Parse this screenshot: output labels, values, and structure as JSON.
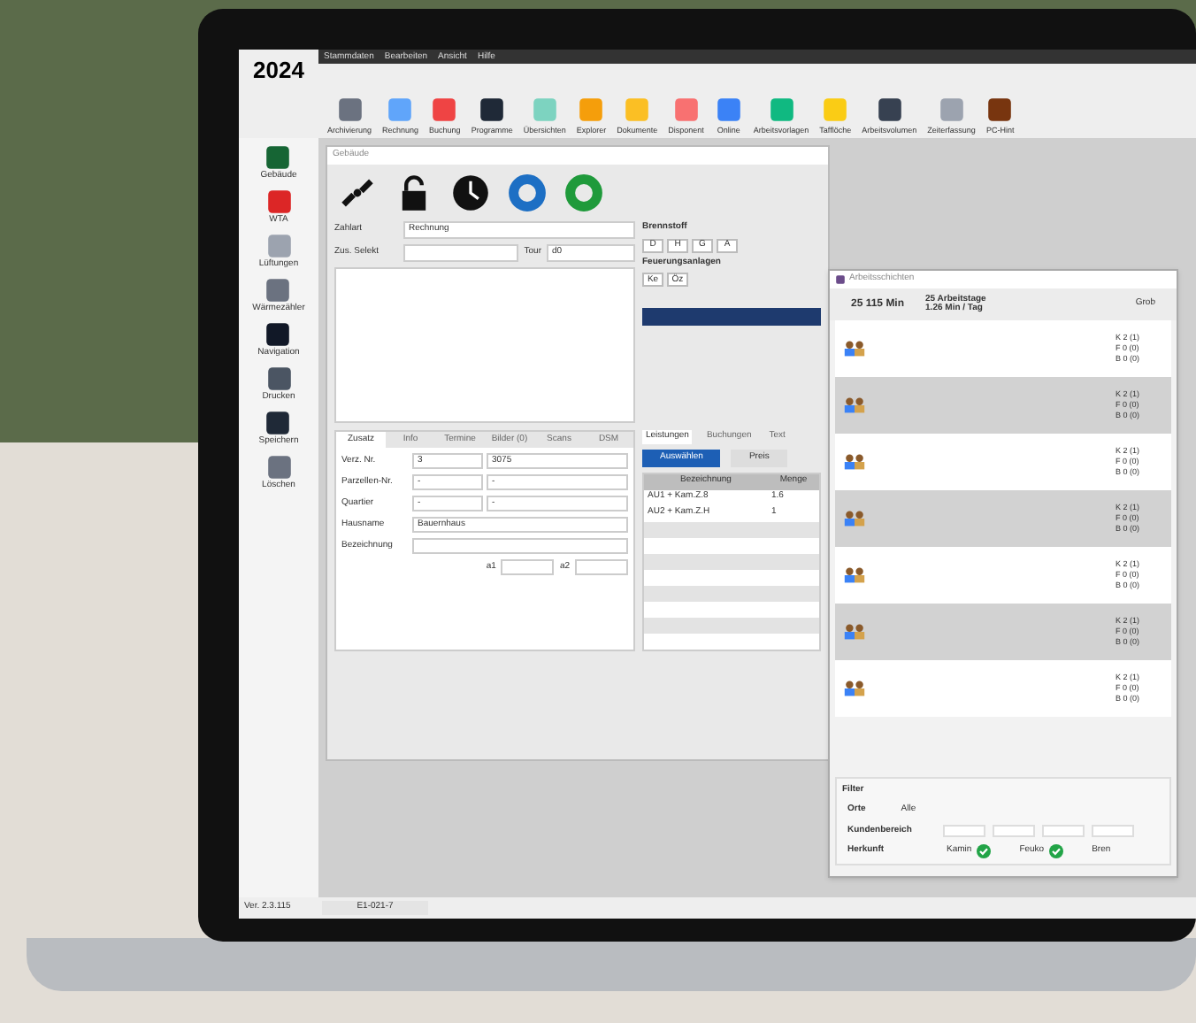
{
  "app": {
    "year": "2024",
    "menu": [
      "Stammdaten",
      "Bearbeiten",
      "Ansicht",
      "Hilfe"
    ],
    "toolbar": [
      {
        "label": "Archivierung"
      },
      {
        "label": "Rechnung"
      },
      {
        "label": "Buchung"
      },
      {
        "label": "Programme"
      },
      {
        "label": "Übersichten"
      },
      {
        "label": "Explorer"
      },
      {
        "label": "Dokumente"
      },
      {
        "label": "Disponent"
      },
      {
        "label": "Online"
      },
      {
        "label": "Arbeitsvorlagen"
      },
      {
        "label": "Tafflöche"
      },
      {
        "label": "Arbeitsvolumen"
      },
      {
        "label": "Zeiterfassung"
      },
      {
        "label": "PC-Hint"
      }
    ],
    "sidebar": [
      {
        "label": "Gebäude"
      },
      {
        "label": "WTA"
      },
      {
        "label": "Lüftungen"
      },
      {
        "label": "Wärmezähler"
      },
      {
        "label": "Navigation"
      },
      {
        "label": "Drucken"
      },
      {
        "label": "Speichern"
      },
      {
        "label": "Löschen"
      }
    ],
    "status_bar": [
      "Ver. 2.3.115",
      "E1-021-7"
    ]
  },
  "building_window": {
    "title": "Gebäude",
    "fields": [
      {
        "label": "Zahlart",
        "value": "Rechnung"
      },
      {
        "label": "Zus. Selekt"
      },
      {
        "label": "Tour",
        "value": "d0"
      }
    ],
    "fuel": {
      "label": "Brennstoff",
      "keys": [
        "D",
        "H",
        "G",
        "A"
      ]
    },
    "firing": {
      "label": "Feuerungsanlagen",
      "keys": [
        "Ke",
        "Öz"
      ]
    },
    "tabs": [
      {
        "label": "Zusatz",
        "selected": true
      },
      {
        "label": "Info",
        "selected": false
      },
      {
        "label": "Termine",
        "selected": false
      },
      {
        "label": "Bilder (0)",
        "selected": false
      },
      {
        "label": "Scans",
        "selected": false
      },
      {
        "label": "DSM",
        "selected": false
      }
    ],
    "form": [
      {
        "label": "Verz. Nr.",
        "values": [
          "3",
          "3075"
        ]
      },
      {
        "label": "Parzellen-Nr.",
        "values": [
          "-",
          "-"
        ]
      },
      {
        "label": "Quartier",
        "values": [
          "-",
          "-"
        ]
      },
      {
        "label": "Hausname",
        "values": [
          "Bauernhaus"
        ]
      },
      {
        "label": "Bezeichnung"
      }
    ],
    "extra_labels": [
      "a1",
      "a2"
    ],
    "right_tabs": [
      {
        "label": "Leistungen",
        "selected": true
      },
      {
        "label": "Buchungen",
        "selected": false
      },
      {
        "label": "Text",
        "selected": false
      }
    ],
    "buttons": [
      "Auswählen",
      "Preis"
    ],
    "table": {
      "columns": [
        "Bezeichnung",
        "Menge"
      ],
      "rows": [
        [
          "AU1 + Kam.Z.8",
          "1.6"
        ],
        [
          "AU2 + Kam.Z.H",
          "1"
        ]
      ]
    }
  },
  "work_window": {
    "title": "Arbeitsschichten",
    "summary": [
      "25 115 Min",
      "25 Arbeitstage",
      "1.26 Min / Tag",
      "Grob"
    ],
    "rows": [
      {
        "counts": [
          "K 2 (1)",
          "F 0 (0)",
          "B 0 (0)"
        ]
      },
      {
        "counts": [
          "K 2 (1)",
          "F 0 (0)",
          "B 0 (0)"
        ]
      },
      {
        "counts": [
          "K 2 (1)",
          "F 0 (0)",
          "B 0 (0)"
        ]
      },
      {
        "counts": [
          "K 2 (1)",
          "F 0 (0)",
          "B 0 (0)"
        ]
      },
      {
        "counts": [
          "K 2 (1)",
          "F 0 (0)",
          "B 0 (0)"
        ]
      },
      {
        "counts": [
          "K 2 (1)",
          "F 0 (0)",
          "B 0 (0)"
        ]
      },
      {
        "counts": [
          "K 2 (1)",
          "F 0 (0)",
          "B 0 (0)"
        ]
      }
    ],
    "filter": {
      "title": "Filter",
      "places_label": "Orte",
      "places_value": "Alle",
      "area_label": "Kundenbereich",
      "origin_label": "Herkunft",
      "origins": [
        {
          "label": "Kamin",
          "checked": true
        },
        {
          "label": "Feuko",
          "checked": true
        },
        {
          "label": "Bren"
        }
      ]
    }
  }
}
